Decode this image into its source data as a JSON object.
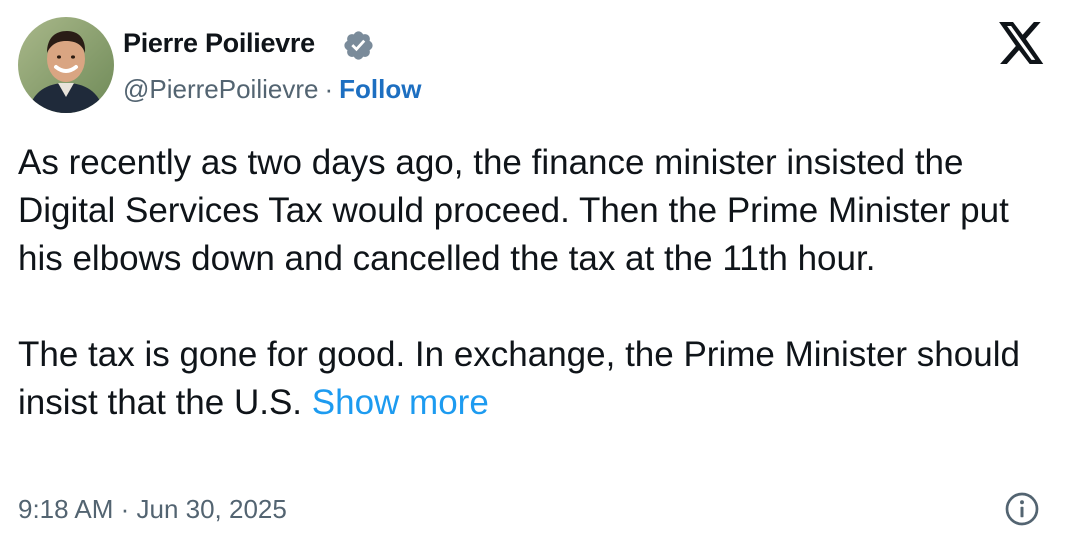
{
  "author": {
    "display_name": "Pierre Poilievre",
    "handle": "@PierrePoilievre",
    "separator": "·",
    "follow_label": "Follow",
    "verified_icon": "verified-badge-icon",
    "avatar_icon": "avatar"
  },
  "tweet": {
    "paragraph_1": "As recently as two days ago, the finance minister insisted the Digital Services Tax would proceed. Then the Prime Minister put his elbows down and cancelled the tax at the 11th hour.",
    "paragraph_2": "The tax is gone for good. In exchange, the Prime Minister should insist that the U.S.",
    "show_more_label": "Show more",
    "timestamp": "9:18 AM · Jun 30, 2025"
  },
  "icons": {
    "brand": "x-logo-icon",
    "info": "info-icon"
  },
  "colors": {
    "text": "#0f1419",
    "secondary": "#536471",
    "follow": "#1d6fc1",
    "link": "#1d9bf0",
    "verified": "#7a8b9a"
  }
}
